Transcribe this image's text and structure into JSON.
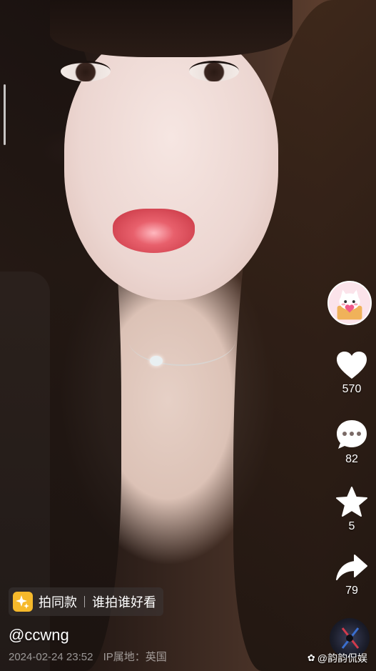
{
  "video": {
    "progress_fraction": 0.1
  },
  "author": {
    "avatar_icon": "cat-avatar-icon"
  },
  "actions": {
    "like_count": "570",
    "comment_count": "82",
    "favorite_count": "5",
    "share_count": "79"
  },
  "template_chip": {
    "label": "拍同款",
    "slogan": "谁拍谁好看"
  },
  "post": {
    "username": "@ccwng",
    "date": "2024-02-24 23:52",
    "ip_location": "IP属地：英国"
  },
  "watermark": {
    "text": "@韵韵侃娱"
  },
  "colors": {
    "accent_gold": "#f6b92b",
    "icon_white": "#ffffff"
  }
}
